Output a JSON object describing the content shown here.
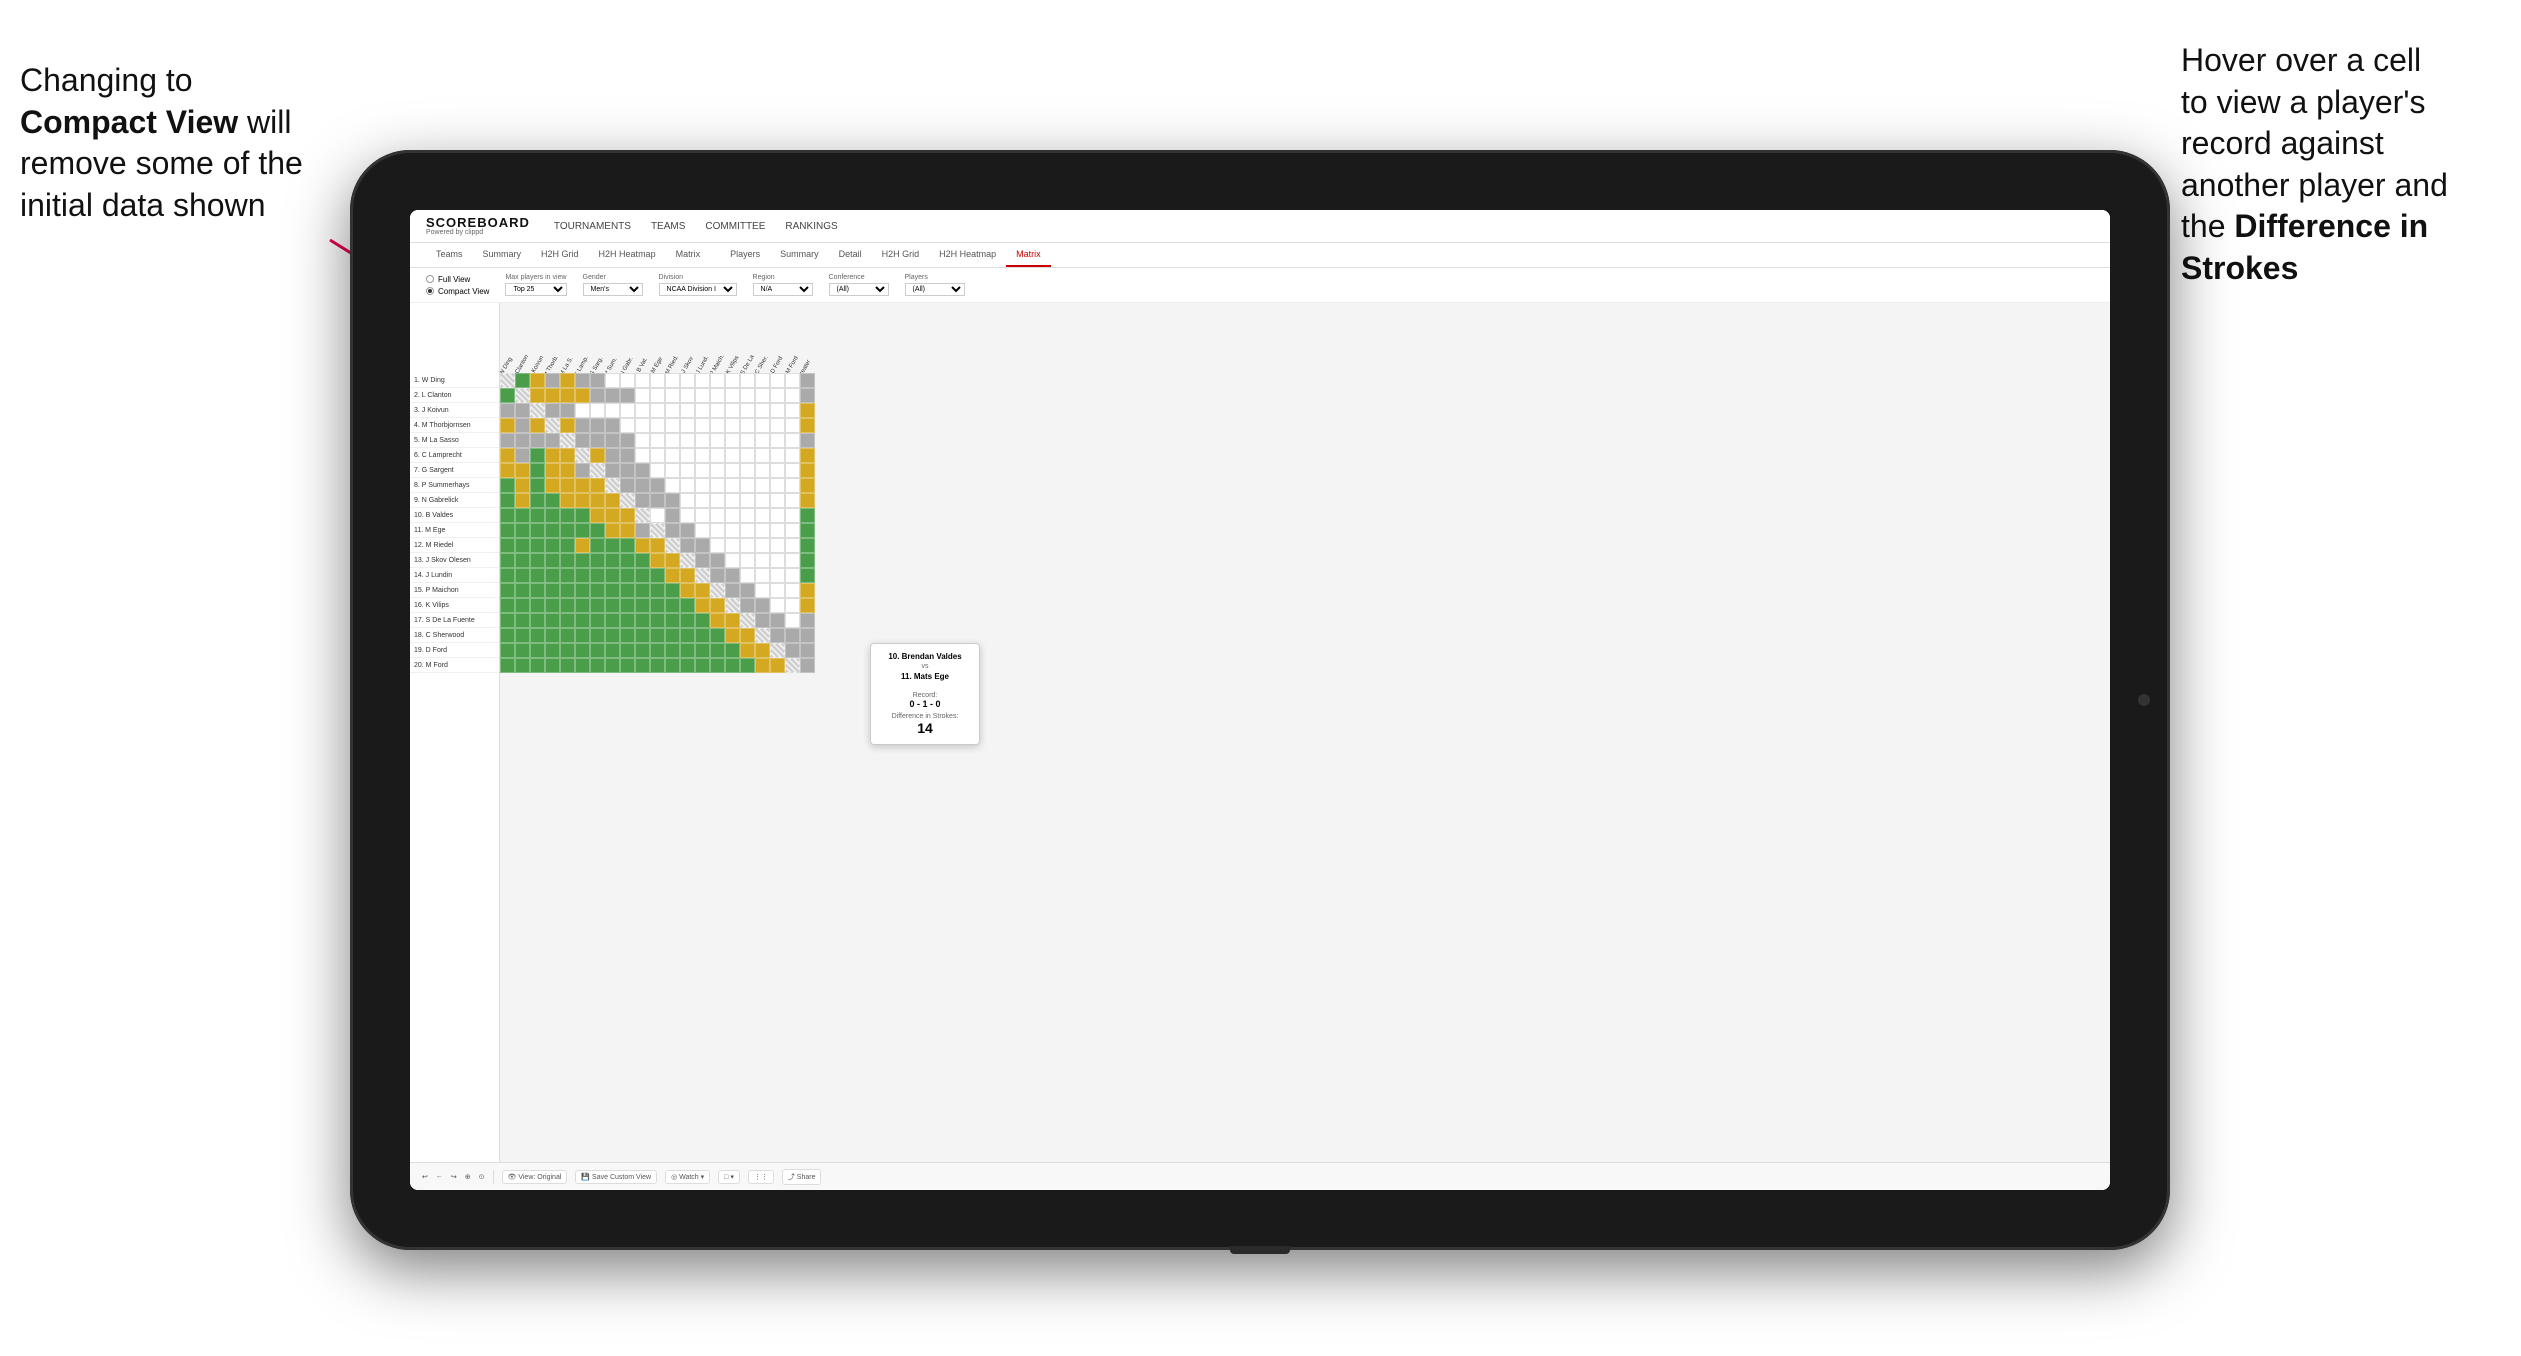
{
  "annotations": {
    "left": {
      "line1": "Changing to",
      "bold": "Compact View",
      "line2": "will",
      "line3": "remove some of the",
      "line4": "initial data shown"
    },
    "right": {
      "line1": "Hover over a cell",
      "line2": "to view a player's",
      "line3": "record against",
      "line4": "another player and",
      "line5": "the",
      "bold": "Difference in",
      "bold2": "Strokes"
    }
  },
  "header": {
    "logo": "SCOREBOARD",
    "logo_sub": "Powered by clippd",
    "nav": [
      "TOURNAMENTS",
      "TEAMS",
      "COMMITTEE",
      "RANKINGS"
    ]
  },
  "tabs": {
    "group1": [
      "Teams",
      "Summary",
      "H2H Grid",
      "H2H Heatmap",
      "Matrix"
    ],
    "group2": [
      "Players",
      "Summary",
      "Detail",
      "H2H Grid",
      "H2H Heatmap",
      "Matrix"
    ],
    "active": "Matrix"
  },
  "controls": {
    "view_options": [
      "Full View",
      "Compact View"
    ],
    "selected_view": "Compact View",
    "filters": [
      {
        "label": "Max players in view",
        "value": "Top 25"
      },
      {
        "label": "Gender",
        "value": "Men's"
      },
      {
        "label": "Division",
        "value": "NCAA Division I"
      },
      {
        "label": "Region",
        "value": "N/A"
      },
      {
        "label": "Conference",
        "value": "(All)"
      },
      {
        "label": "Players",
        "value": "(All)"
      }
    ]
  },
  "players": [
    "1. W Ding",
    "2. L Clanton",
    "3. J Koivun",
    "4. M Thorbjornsen",
    "5. M La Sasso",
    "6. C Lamprecht",
    "7. G Sargent",
    "8. P Summerhays",
    "9. N Gabrelick",
    "10. B Valdes",
    "11. M Ege",
    "12. M Riedel",
    "13. J Skov Olesen",
    "14. J Lundin",
    "15. P Maichon",
    "16. K Vilips",
    "17. S De La Fuente",
    "18. C Sherwood",
    "19. D Ford",
    "20. M Ford"
  ],
  "column_headers": [
    "1. W Ding",
    "2. L Clanton",
    "3. J Koivun",
    "4. M Thorb.",
    "5. M La S.",
    "6. C Lamp.",
    "7. G Sarg.",
    "8. P Sum.",
    "9. N Gabr.",
    "10. B Val.",
    "11. M Ege",
    "12. M Ried.",
    "13. J Skov",
    "14. J Lund.",
    "15. P Maich.",
    "16. K Vilips",
    "17. S De La",
    "18. C Sher.",
    "19. D Ford",
    "20. M Ford",
    "Greater"
  ],
  "tooltip": {
    "player1": "10. Brendan Valdes",
    "vs": "vs",
    "player2": "11. Mats Ege",
    "record_label": "Record:",
    "record": "0 - 1 - 0",
    "strokes_label": "Difference in Strokes:",
    "strokes": "14"
  },
  "bottom_toolbar": {
    "buttons": [
      "↩",
      "←",
      "↪",
      "⊕",
      "⊙",
      "○",
      "◎",
      "View: Original",
      "Save Custom View",
      "Watch ▾",
      "□ ▾",
      "⋮⋮⋮",
      "Share"
    ]
  }
}
